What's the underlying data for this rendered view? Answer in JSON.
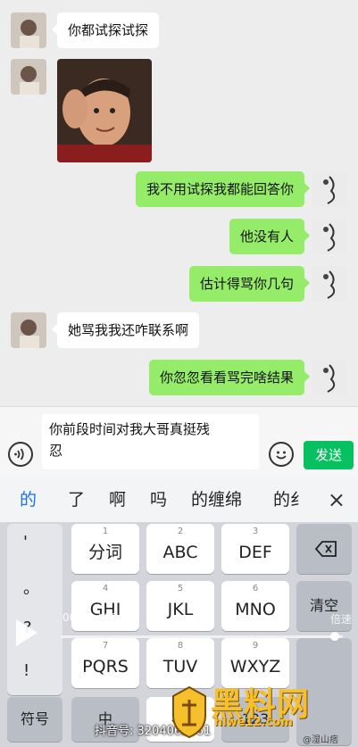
{
  "chat": {
    "messages": [
      {
        "side": "left",
        "text": "你都试探试探"
      },
      {
        "side": "left",
        "type": "sticker"
      },
      {
        "side": "right",
        "text": "我不用试探我都能回答你"
      },
      {
        "side": "right",
        "text": "他没有人"
      },
      {
        "side": "right",
        "text": "估计得骂你几句"
      },
      {
        "side": "left",
        "text": "她骂我我还咋联系啊"
      },
      {
        "side": "right",
        "text": "你忽忽看看骂完啥结果"
      }
    ]
  },
  "input": {
    "value": "你前段时间对我大哥真挺残忍",
    "line1": "你前段时间对我大哥真挺残",
    "line2": "忍",
    "send_label": "发送"
  },
  "keyboard": {
    "candidates": [
      "的",
      "了",
      "啊",
      "吗",
      "的缠绵",
      "的纟"
    ],
    "close_icon": "×",
    "left_symbols": [
      "'",
      "。",
      "?",
      "!"
    ],
    "keys_row1": [
      {
        "num": "1",
        "label": "分词"
      },
      {
        "num": "2",
        "label": "ABC"
      },
      {
        "num": "3",
        "label": "DEF"
      }
    ],
    "keys_row2": [
      {
        "num": "4",
        "label": "GHI"
      },
      {
        "num": "5",
        "label": "JKL"
      },
      {
        "num": "6",
        "label": "MNO"
      }
    ],
    "keys_row3": [
      {
        "num": "7",
        "label": "PQRS"
      },
      {
        "num": "8",
        "label": "TUV"
      },
      {
        "num": "9",
        "label": "WXYZ"
      }
    ],
    "bottom_row": {
      "symbols_label": "符号",
      "zh_label": "中",
      "num_label": "123"
    },
    "right_col": {
      "clear_label": "清空"
    }
  },
  "video": {
    "time": "00:07 / 00:52",
    "speed": "倍速",
    "progress_fraction": 0.97
  },
  "watermarks": {
    "douyin": "抖音号: 3204062061",
    "site_name": "黑料网",
    "site_url": "hlwe12.com",
    "weibo": "@湿山痞"
  }
}
